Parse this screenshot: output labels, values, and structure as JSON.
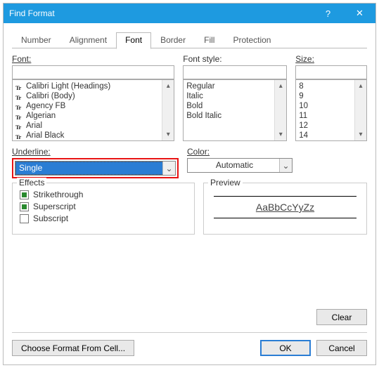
{
  "title": "Find Format",
  "tabs": [
    "Number",
    "Alignment",
    "Font",
    "Border",
    "Fill",
    "Protection"
  ],
  "active_tab": "Font",
  "labels": {
    "font": "Font:",
    "style": "Font style:",
    "size": "Size:",
    "underline": "Underline:",
    "color": "Color:",
    "effects": "Effects",
    "preview": "Preview"
  },
  "fonts": [
    "Calibri Light (Headings)",
    "Calibri (Body)",
    "Agency FB",
    "Algerian",
    "Arial",
    "Arial Black"
  ],
  "styles": [
    "Regular",
    "Italic",
    "Bold",
    "Bold Italic"
  ],
  "sizes": [
    "8",
    "9",
    "10",
    "11",
    "12",
    "14"
  ],
  "underline_value": "Single",
  "color_value": "Automatic",
  "effects_list": {
    "strike": {
      "label": "Strikethrough",
      "state": "indeterminate"
    },
    "super": {
      "label": "Superscript",
      "state": "indeterminate"
    },
    "sub": {
      "label": "Subscript",
      "state": "unchecked"
    }
  },
  "preview_sample": "AaBbCcYyZz",
  "buttons": {
    "choose": "Choose Format From Cell...",
    "ok": "OK",
    "cancel": "Cancel",
    "clear": "Clear"
  },
  "icons": {
    "close_glyph": "✕",
    "help_glyph": "?",
    "chevron_down": "⌄",
    "tri_up": "▴",
    "tri_down": "▾"
  }
}
